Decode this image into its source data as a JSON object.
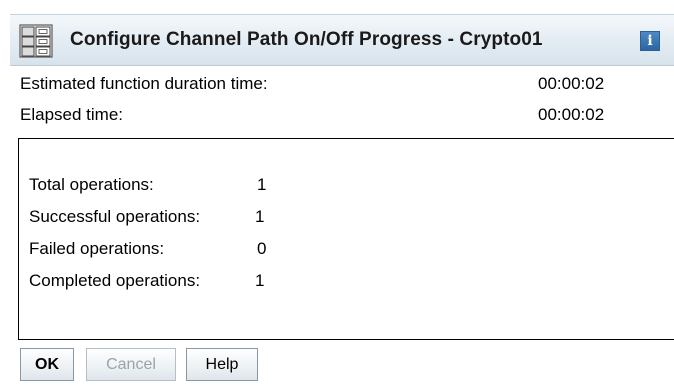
{
  "title": "Configure Channel Path On/Off Progress - Crypto01",
  "icons": {
    "title_icon": "hardware-frames-icon",
    "info_icon": "info-icon",
    "info_glyph": "i"
  },
  "summary": {
    "estimated_label": "Estimated function duration time:",
    "estimated_value": "00:00:02",
    "elapsed_label": "Elapsed time:",
    "elapsed_value": "00:00:02"
  },
  "operations": {
    "total_label": "Total operations:",
    "total_value": "1",
    "successful_label": "Successful operations:",
    "successful_value": "1",
    "failed_label": "Failed operations:",
    "failed_value": "0",
    "completed_label": "Completed operations:",
    "completed_value": "1"
  },
  "buttons": {
    "ok": "OK",
    "cancel": "Cancel",
    "help": "Help"
  },
  "colors": {
    "titlebar": "#e6eef4",
    "info_icon": "#2c65a3",
    "disabled_text": "#9aa3ab"
  }
}
